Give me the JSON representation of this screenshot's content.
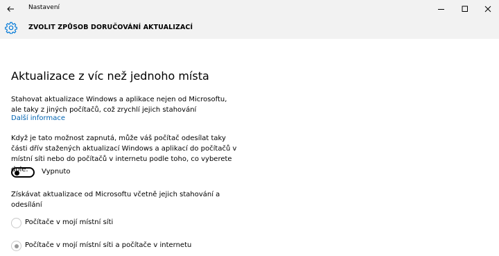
{
  "window": {
    "title": "Nastavení"
  },
  "header": {
    "title": "ZVOLIT ZPŮSOB DORUČOVÁNÍ AKTUALIZACÍ"
  },
  "main": {
    "section_title": "Aktualizace z víc než jednoho místa",
    "intro_text": "Stahovat aktualizace Windows a aplikace nejen od Microsoftu, ale taky z jiných počítačů, což zrychlí jejich stahování",
    "learn_more_link": "Další informace",
    "toggle_description": "Když je tato možnost zapnutá, může váš počítač odesílat taky části dřív stažených aktualizací Windows a aplikací do počítačů v místní síti nebo do počítačů v internetu podle toho, co vyberete dole.",
    "toggle": {
      "state_label": "Vypnuto",
      "on": false
    },
    "options_description": "Získávat aktualizace od Microsoftu včetně jejich stahování a odesílání",
    "radio_options": [
      {
        "label": "Počítače v mojí místní síti",
        "selected": false
      },
      {
        "label": "Počítače v mojí místní síti a počítače v internetu",
        "selected": true
      }
    ]
  },
  "colors": {
    "titlebar_bg": "#f2f2f2",
    "link": "#0063b1",
    "accent_icon": "#0078d7",
    "disabled": "#999999"
  }
}
